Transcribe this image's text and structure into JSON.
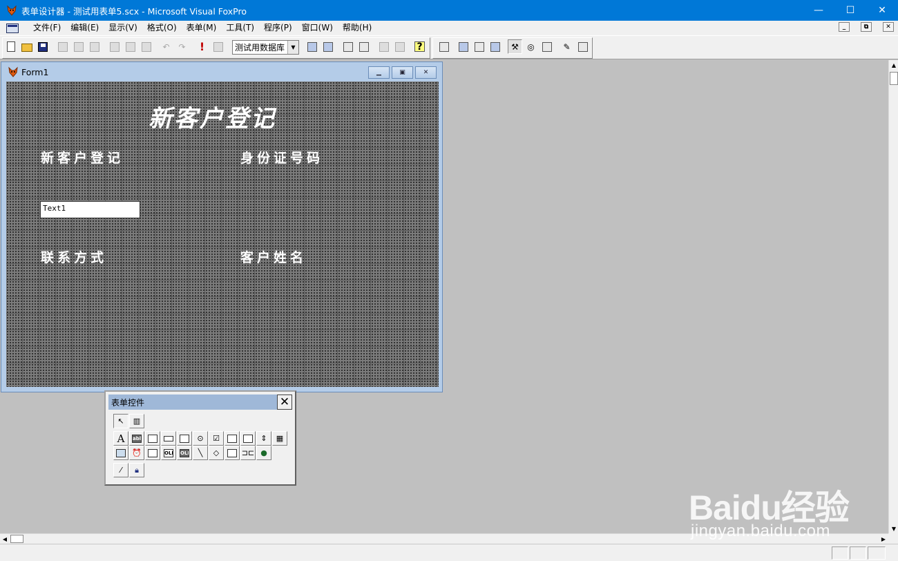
{
  "window": {
    "title": "表单设计器 - 测试用表单5.scx - Microsoft Visual FoxPro",
    "minimize_glyph": "—",
    "maximize_glyph": "☐",
    "close_glyph": "✕"
  },
  "menu": {
    "items": [
      "文件(F)",
      "编辑(E)",
      "显示(V)",
      "格式(O)",
      "表单(M)",
      "工具(T)",
      "程序(P)",
      "窗口(W)",
      "帮助(H)"
    ],
    "mdi_minimize": "_",
    "mdi_restore": "⧉",
    "mdi_close": "✕"
  },
  "toolbar": {
    "database_selected": "测试用数据库",
    "run_glyph": "!",
    "help_glyph": "?",
    "icons": {
      "new": "new-file-icon",
      "open": "open-folder-icon",
      "save": "save-disk-icon",
      "print": "print-icon",
      "preview": "print-preview-icon",
      "spell": "spelling-icon",
      "cut": "cut-icon",
      "copy": "copy-icon",
      "paste": "paste-icon",
      "undo": "undo-icon",
      "redo": "redo-icon",
      "run": "run-icon",
      "modify": "modify-icon"
    }
  },
  "form_window": {
    "caption": "Form1",
    "heading": "新客户登记",
    "labels": {
      "label_top_left": "新客户登记",
      "label_top_right": "身份证号码",
      "label_bottom_left": "联系方式",
      "label_bottom_right": "客户姓名"
    },
    "textbox_value": "Text1"
  },
  "toolbox": {
    "title": "表单控件",
    "close_glyph": "✕",
    "label_glyph": "A",
    "textbox_glyph": "abl",
    "pointer_glyph": "↖"
  },
  "watermark": {
    "logo": "Baidu经验",
    "url": "jingyan.baidu.com"
  },
  "colors": {
    "titlebar": "#0078d7",
    "workspace": "#c0c0c0",
    "form_background": "#7b7b7b",
    "form_window_frame": "#b4cce8"
  }
}
